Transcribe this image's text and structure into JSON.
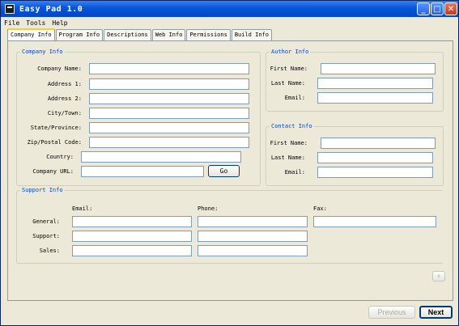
{
  "window": {
    "title": "Easy Pad 1.0",
    "minimize": "_",
    "maximize": "□",
    "close": "✕"
  },
  "menu": [
    "File",
    "Tools",
    "Help"
  ],
  "tabs": [
    "Company Info",
    "Program Info",
    "Descriptions",
    "Web Info",
    "Permissions",
    "Build Info"
  ],
  "company": {
    "legend": "Company Info",
    "labels": [
      "Company Name:",
      "Address 1:",
      "Address 2:",
      "City/Town:",
      "State/Province:",
      "Zip/Postal Code:",
      "Country:",
      "Company URL:"
    ],
    "go_label": "Go"
  },
  "author": {
    "legend": "Author Info",
    "labels": [
      "First Name:",
      "Last Name:",
      "Email:"
    ]
  },
  "contact": {
    "legend": "Contact Info",
    "labels": [
      "First Name:",
      "Last Name:",
      "Email:"
    ]
  },
  "support": {
    "legend": "Support Info",
    "col_headers": [
      "Email:",
      "Phone:",
      "Fax:"
    ],
    "row_labels": [
      "General:",
      "Support:",
      "Sales:"
    ]
  },
  "small_button": "o",
  "footer": {
    "previous": "Previous",
    "next": "Next"
  }
}
